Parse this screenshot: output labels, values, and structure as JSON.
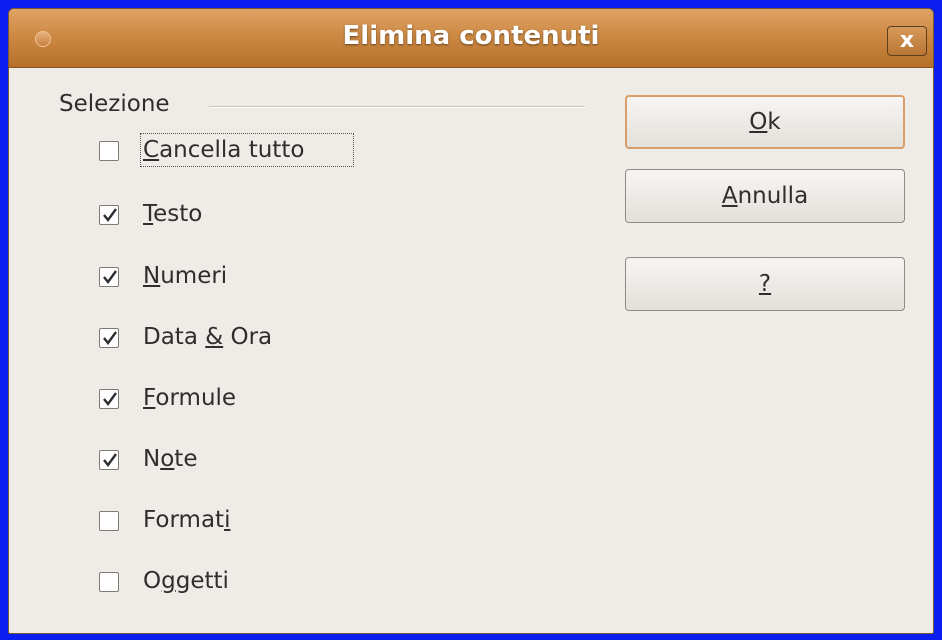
{
  "dialog": {
    "title": "Elimina contenuti",
    "close_label": "x"
  },
  "selection": {
    "group_label": "Selezione",
    "options": [
      {
        "pre": "",
        "u": "C",
        "post": "ancella tutto",
        "checked": false
      },
      {
        "pre": "",
        "u": "T",
        "post": "esto",
        "checked": true
      },
      {
        "pre": "",
        "u": "N",
        "post": "umeri",
        "checked": true
      },
      {
        "pre": "Data ",
        "u": "&",
        "post": " Ora",
        "checked": true
      },
      {
        "pre": "",
        "u": "F",
        "post": "ormule",
        "checked": true
      },
      {
        "pre": "N",
        "u": "o",
        "post": "te",
        "checked": true
      },
      {
        "pre": "Format",
        "u": "i",
        "post": "",
        "checked": false
      },
      {
        "pre": "O",
        "u": "g",
        "post": "getti",
        "checked": false
      }
    ]
  },
  "buttons": {
    "ok": {
      "u": "O",
      "post": "k"
    },
    "cancel": {
      "u": "A",
      "post": "nnulla"
    },
    "help": {
      "u": "?",
      "post": ""
    }
  },
  "colors": {
    "titlebar": "#cd8a44",
    "dialog_bg": "#efebe7",
    "desktop_bg": "#0a1ef0"
  }
}
